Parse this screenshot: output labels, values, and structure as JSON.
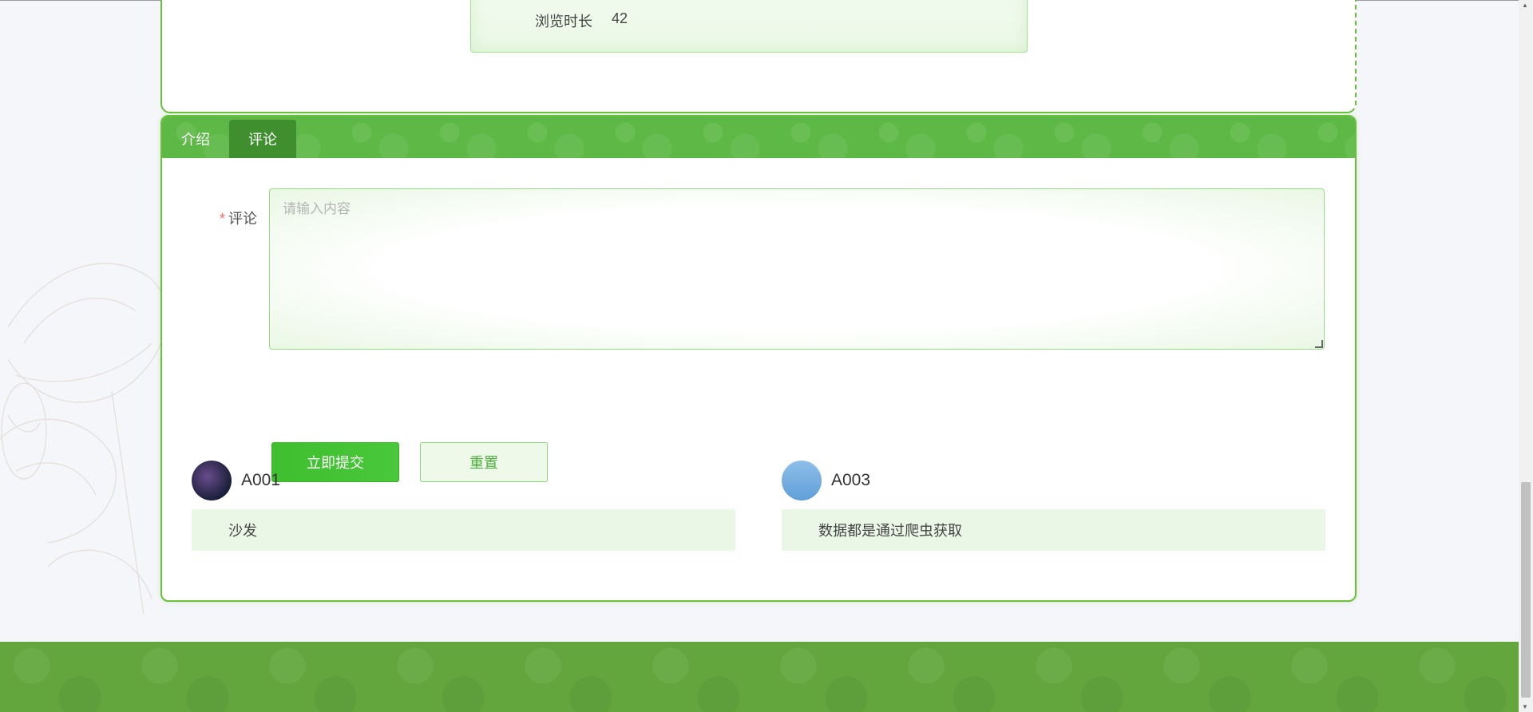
{
  "stats": {
    "label": "浏览时长",
    "value": "42"
  },
  "tabs": [
    {
      "label": "介绍",
      "active": false
    },
    {
      "label": "评论",
      "active": true
    }
  ],
  "comment_form": {
    "label": "评论",
    "required_mark": "*",
    "placeholder": "请输入内容",
    "value": "",
    "submit_label": "立即提交",
    "reset_label": "重置"
  },
  "comments": [
    {
      "user": "A001",
      "text": "沙发",
      "avatar": "avatar-dark-image"
    },
    {
      "user": "A003",
      "text": "数据都是通过爬虫获取",
      "avatar": "avatar-blue-gradient"
    }
  ],
  "colors": {
    "accent": "#67c23a",
    "tab_bar": "#5db845",
    "tab_active": "#3f8f2e",
    "footer": "#62a63d",
    "required": "#f56c6c"
  }
}
